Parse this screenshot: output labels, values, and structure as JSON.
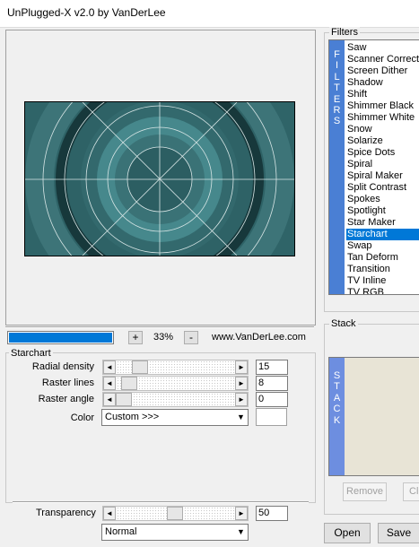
{
  "window": {
    "title": "UnPlugged-X v2.0 by VanDerLee"
  },
  "preview": {
    "zoom_minus": "-",
    "zoom_plus": "+",
    "zoom": "33%",
    "url": "www.VanDerLee.com",
    "progress": 1.0
  },
  "filters": {
    "title": "Filters",
    "band_letters": [
      "F",
      "I",
      "L",
      "T",
      "E",
      "R",
      "S"
    ],
    "items": [
      "Saw",
      "Scanner Correct",
      "Screen Dither",
      "Shadow",
      "Shift",
      "Shimmer Black",
      "Shimmer White",
      "Snow",
      "Solarize",
      "Spice Dots",
      "Spiral",
      "Spiral Maker",
      "Split Contrast",
      "Spokes",
      "Spotlight",
      "Star Maker",
      "Starchart",
      "Swap",
      "Tan Deform",
      "Transition",
      "TV Inline",
      "TV RGB"
    ],
    "selected": "Starchart"
  },
  "stack": {
    "title": "Stack",
    "band_letters": [
      "S",
      "T",
      "A",
      "C",
      "K"
    ],
    "remove_label": "Remove",
    "clear_label": "Cl"
  },
  "params": {
    "group_title": "Starchart",
    "radial_density": {
      "label": "Radial density",
      "value": "15"
    },
    "raster_lines": {
      "label": "Raster lines",
      "value": "8"
    },
    "raster_angle": {
      "label": "Raster angle",
      "value": "0"
    },
    "color": {
      "label": "Color",
      "value": "Custom >>>"
    }
  },
  "transparency": {
    "label": "Transparency",
    "value": "50",
    "blend_mode": "Normal"
  },
  "buttons": {
    "open": "Open",
    "save": "Save"
  },
  "icons": {
    "left_arrow": "◄",
    "right_arrow": "►",
    "down_arrow": "▼"
  },
  "colors": {
    "selection": "#0078d7",
    "filters_band": "#4a7fd4",
    "stack_band": "#6d8ee0",
    "progress": "#0078d7"
  }
}
